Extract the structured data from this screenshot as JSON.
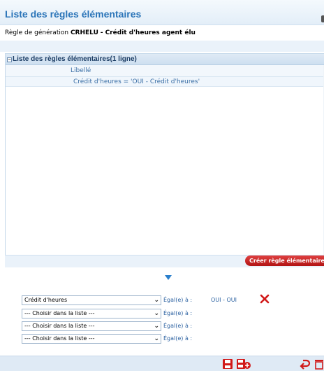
{
  "page": {
    "title": "Liste des règles élémentaires",
    "subtitle_prefix": "Règle de génération",
    "rule_code": "CRHELU",
    "rule_label": "- Crédit d'heures agent élu"
  },
  "panel": {
    "header": "Liste des règles élémentaires(1 ligne)",
    "collapse_symbol": "⊟",
    "columns": [
      "Libellé"
    ],
    "rows": [
      {
        "libelle": "Crédit d'heures = 'OUI - Crédit d'heures'"
      }
    ],
    "create_button": "Créer règle élémentaire"
  },
  "criteria": [
    {
      "field": "Crédit d'heures",
      "operator": "Égal(e) à :",
      "value": "OUI - OUI"
    },
    {
      "field": "--- Choisir dans la liste ---",
      "operator": "Égal(e) à :",
      "value": ""
    },
    {
      "field": "--- Choisir dans la liste ---",
      "operator": "Égal(e) à :",
      "value": ""
    },
    {
      "field": "--- Choisir dans la liste ---",
      "operator": "Égal(e) à :",
      "value": ""
    }
  ],
  "colors": {
    "title": "#2a74b8",
    "accent_red": "#c21a1a",
    "link_blue": "#3a6ea5"
  },
  "icons": {
    "delete": "delete-x-icon",
    "save": "save-icon",
    "save_new": "save-new-icon",
    "back": "back-arrow-icon",
    "trash": "trash-icon"
  }
}
